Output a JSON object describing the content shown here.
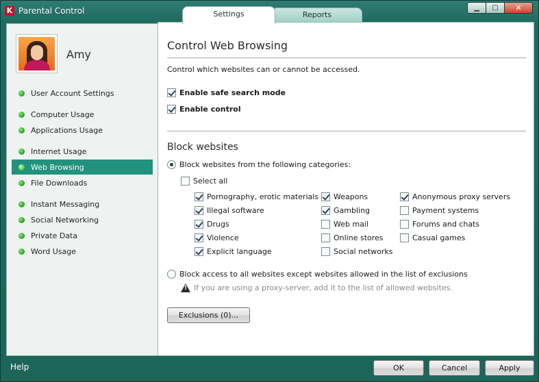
{
  "window": {
    "title": "Parental Control",
    "tabs": [
      {
        "label": "Settings",
        "active": true
      },
      {
        "label": "Reports",
        "active": false
      }
    ],
    "controls": {
      "minimize": "▁",
      "maximize": "▢",
      "close": "✕"
    }
  },
  "user": {
    "name": "Amy"
  },
  "sidebar": {
    "items": [
      {
        "label": "User Account Settings",
        "selected": false
      },
      {
        "label": "Computer Usage",
        "selected": false
      },
      {
        "label": "Applications Usage",
        "selected": false
      },
      {
        "label": "Internet Usage",
        "selected": false
      },
      {
        "label": "Web Browsing",
        "selected": true
      },
      {
        "label": "File Downloads",
        "selected": false
      },
      {
        "label": "Instant Messaging",
        "selected": false
      },
      {
        "label": "Social Networking",
        "selected": false
      },
      {
        "label": "Private Data",
        "selected": false
      },
      {
        "label": "Word Usage",
        "selected": false
      }
    ]
  },
  "main": {
    "title": "Control Web Browsing",
    "description": "Control which websites can or cannot be accessed.",
    "safe_search": {
      "label": "Enable safe search mode",
      "checked": true
    },
    "enable_control": {
      "label": "Enable control",
      "checked": true
    },
    "block_section_title": "Block websites",
    "radio_categories": {
      "label": "Block websites from the following categories:",
      "checked": true
    },
    "select_all": {
      "label": "Select all",
      "checked": false
    },
    "categories": [
      {
        "label": "Pornography, erotic materials",
        "checked": true
      },
      {
        "label": "Illegal software",
        "checked": true
      },
      {
        "label": "Drugs",
        "checked": true
      },
      {
        "label": "Violence",
        "checked": true
      },
      {
        "label": "Explicit language",
        "checked": true
      },
      {
        "label": "Weapons",
        "checked": true
      },
      {
        "label": "Gambling",
        "checked": true
      },
      {
        "label": "Web mail",
        "checked": false
      },
      {
        "label": "Online stores",
        "checked": false
      },
      {
        "label": "Social networks",
        "checked": false
      },
      {
        "label": "Anonymous proxy servers",
        "checked": true
      },
      {
        "label": "Payment systems",
        "checked": false
      },
      {
        "label": "Forums and chats",
        "checked": false
      },
      {
        "label": "Casual games",
        "checked": false
      }
    ],
    "radio_all": {
      "label": "Block access to all websites except websites allowed in the list of exclusions",
      "checked": false
    },
    "proxy_note": "If you are using a proxy-server, add it to the list of allowed websites.",
    "exclusions_button": "Exclusions (0)..."
  },
  "footer": {
    "help": "Help",
    "ok": "OK",
    "cancel": "Cancel",
    "apply": "Apply"
  },
  "colors": {
    "frame": "#1e6a5f",
    "selected_nav": "#23917f",
    "bullet": "#33a82a"
  }
}
